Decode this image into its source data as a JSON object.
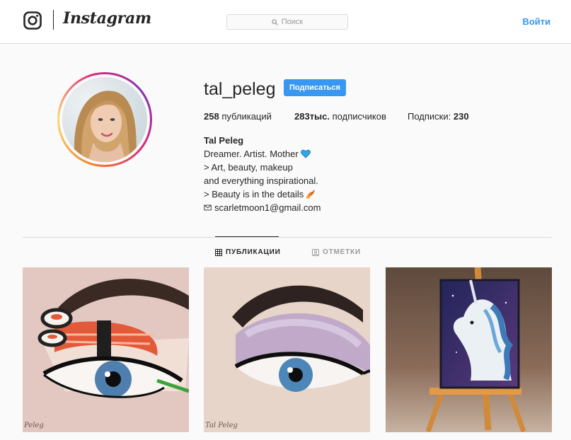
{
  "header": {
    "logo_icon": "instagram-camera-icon",
    "wordmark": "Instagram",
    "search": {
      "placeholder": "Поиск",
      "icon": "search-icon"
    },
    "login_label": "Войти"
  },
  "profile": {
    "username": "tal_peleg",
    "follow_label": "Подписаться",
    "stats": {
      "posts_count": "258",
      "posts_label": "публикаций",
      "followers_count": "283тыс.",
      "followers_label": "подписчиков",
      "following_label": "Подписки:",
      "following_count": "230"
    },
    "bio": {
      "name": "Tal Peleg",
      "line1": "Dreamer. Artist. Mother",
      "line1_icon": "blue-heart-icon",
      "line2": "> Art, beauty, makeup",
      "line3": "and everything inspirational.",
      "line4": "> Beauty is in the details",
      "line4_icon": "nail-polish-icon",
      "email_icon": "envelope-icon",
      "email": "scarletmoon1@gmail.com"
    }
  },
  "tabs": [
    {
      "label": "ПУБЛИКАЦИИ",
      "icon": "grid-icon",
      "active": true
    },
    {
      "label": "ОТМЕТКИ",
      "icon": "tagged-user-icon",
      "active": false
    }
  ],
  "posts": [
    {
      "subject": "sushi eye makeup",
      "icon": "post-thumbnail",
      "watermark": "Peleg"
    },
    {
      "subject": "purple eye makeup",
      "icon": "post-thumbnail",
      "watermark": "Tal Peleg"
    },
    {
      "subject": "unicorn painting on easel",
      "icon": "post-thumbnail"
    }
  ],
  "colors": {
    "accent": "#3897f0",
    "text": "#262626",
    "muted": "#999999",
    "border": "#dbdbdb",
    "background": "#fafafa"
  }
}
